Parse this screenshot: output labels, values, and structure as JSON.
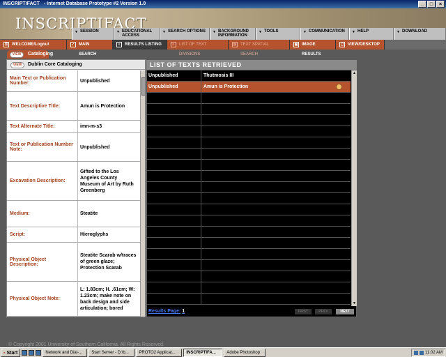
{
  "window": {
    "app_name": "INSCRIPTIFACT",
    "title": "Internet Database Prototype #2 Version 1.0"
  },
  "logo": {
    "text": "INSCRIPTIFACT"
  },
  "top_nav": [
    "SESSION",
    "EDUCATIONAL ACCESS",
    "SEARCH OPTIONS",
    "BACKGROUND INFORMATION",
    "TOOLS",
    "COMMUNICATION",
    "HELP",
    "DOWNLOAD"
  ],
  "tabs": [
    {
      "label": "WELCOME/Logout",
      "state": "orange"
    },
    {
      "label": "MAIN SEARCH",
      "state": "orange"
    },
    {
      "label": "RESULTS LISTING",
      "state": "active"
    },
    {
      "label": "LIST OF TEXT DIVISIONS",
      "state": "dim"
    },
    {
      "label": "TEXT SPATIAL SEARCH",
      "state": "dim"
    },
    {
      "label": "IMAGE RESULTS",
      "state": "orange"
    },
    {
      "label": "VIEW/DESKTOP",
      "state": "orange"
    }
  ],
  "left_panel": {
    "view_label": "VIEW",
    "tab_title": "Cataloging",
    "section_title": "Dublin Core Cataloging",
    "fields": [
      {
        "label": "Main Text or Publication Number:",
        "value": "Unpublished"
      },
      {
        "label": "Text Descriptive Title:",
        "value": "Amun is Protection"
      },
      {
        "label": "Text Alternate Title:",
        "value": "imn-m-s3"
      },
      {
        "label": "Text or Publication Number Note:",
        "value": "Unpublished"
      },
      {
        "label": "Excavation Description:",
        "value": "Gifted to the Los Angeles County Museum of Art by Ruth Greenberg"
      },
      {
        "label": "Medium:",
        "value": "Steatite"
      },
      {
        "label": "Script:",
        "value": "Hieroglyphs"
      },
      {
        "label": "Physical Object Description:",
        "value": "Steatite Scarab w/traces of green glaze; Protection Scarab"
      },
      {
        "label": "Physical Object Note:",
        "value": "L: 1.83cm; H. .61cm; W: 1.23cm; make note on back design and side articulation; bored"
      }
    ]
  },
  "right_panel": {
    "title": "LIST OF TEXTS RETRIEVED",
    "rows": [
      {
        "col1": "Unpublished",
        "col2": "Thutmosis III",
        "selected": false
      },
      {
        "col1": "Unpublished",
        "col2": "Amun is Protection",
        "selected": true
      }
    ],
    "results_page_label": "Results Page:",
    "results_page_number": "1",
    "pager": {
      "first": "FIRST",
      "prev": "PREV",
      "next": "NEXT"
    }
  },
  "copyright": "© Copyright 2001 University of Southern California. All Rights Reserved.",
  "taskbar": {
    "start": "Start",
    "tasks": [
      {
        "label": "Network and Dial-...",
        "active": false
      },
      {
        "label": "Start Server - D:\\b...",
        "active": false
      },
      {
        "label": "PROTO2 Applicat...",
        "active": false
      },
      {
        "label": "INSCRIPTIFA...",
        "active": true
      },
      {
        "label": "Adobe Photoshop",
        "active": false
      }
    ],
    "clock": "11:02 AM"
  }
}
